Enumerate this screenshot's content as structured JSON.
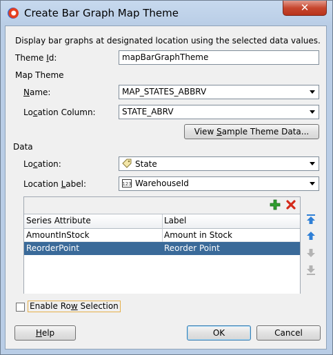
{
  "window": {
    "title": "Create Bar Graph Map Theme",
    "close_symbol": "✕"
  },
  "description": "Display bar graphs at designated location using the selected data values.",
  "theme_id": {
    "label_pre": "Theme ",
    "label_mn": "I",
    "label_post": "d:",
    "value": "mapBarGraphTheme"
  },
  "map_theme": {
    "section_label": "Map Theme",
    "name": {
      "label_pre": "",
      "label_mn": "N",
      "label_post": "ame:",
      "value": "MAP_STATES_ABBRV"
    },
    "location_column": {
      "label_pre": "Lo",
      "label_mn": "c",
      "label_post": "ation Column:",
      "value": "STATE_ABRV"
    },
    "view_sample_button": {
      "pre": "View ",
      "mn": "S",
      "post": "ample Theme Data..."
    }
  },
  "data": {
    "section_label": "Data",
    "location": {
      "label_pre": "Lo",
      "label_mn": "c",
      "label_post": "ation:",
      "value": "State",
      "icon": "tag-icon"
    },
    "location_label": {
      "label_pre": "Location ",
      "label_mn": "L",
      "label_post": "abel:",
      "value": "WarehouseId",
      "icon": "numeric-type-icon"
    }
  },
  "series_table": {
    "columns": [
      "Series Attribute",
      "Label"
    ],
    "rows": [
      {
        "attribute": "AmountInStock",
        "label": "Amount in Stock",
        "selected": false
      },
      {
        "attribute": "ReorderPoint",
        "label": "Reorder Point",
        "selected": true
      }
    ],
    "icons": [
      "add-icon",
      "delete-icon",
      "move-top-icon",
      "move-up-icon",
      "move-down-icon",
      "move-bottom-icon"
    ],
    "colors": {
      "add": "#2f9e2f",
      "delete": "#d42a1a",
      "move_enabled": "#2e7fd6",
      "move_disabled": "#b3b3b3",
      "selection": "#3a6a99"
    }
  },
  "enable_row_selection": {
    "label_pre": "Enable Ro",
    "label_mn": "w",
    "label_post": " Selection",
    "checked": false
  },
  "buttons": {
    "help": {
      "pre": "",
      "mn": "H",
      "post": "elp"
    },
    "ok": "OK",
    "cancel": "Cancel"
  }
}
